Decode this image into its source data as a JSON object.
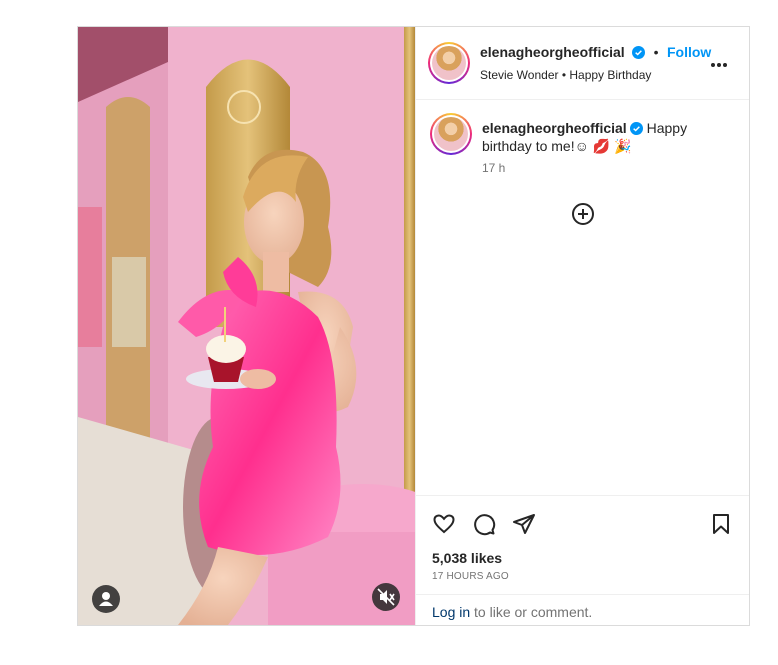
{
  "post": {
    "username": "elenagheorgheofficial",
    "follow_label": "Follow",
    "separator": "•",
    "audio": "Stevie Wonder • Happy Birthday",
    "caption": "Happy birthday to me!☺ 💋 🎉",
    "time": "17 h",
    "likes": "5,038 likes",
    "time_ago": "17 HOURS AGO",
    "login_link": "Log in",
    "login_rest": " to like or comment."
  },
  "icons": {
    "more": "more-options-icon",
    "add": "add-circle-icon",
    "like": "heart-icon",
    "comment": "comment-icon",
    "share": "share-icon",
    "save": "bookmark-icon",
    "user": "user-tag-icon",
    "mute": "muted-speaker-icon"
  },
  "colors": {
    "accent": "#0095f6",
    "verified": "#0095f6",
    "dress": "#ff4fa3",
    "wall": "#f2b3cf"
  }
}
